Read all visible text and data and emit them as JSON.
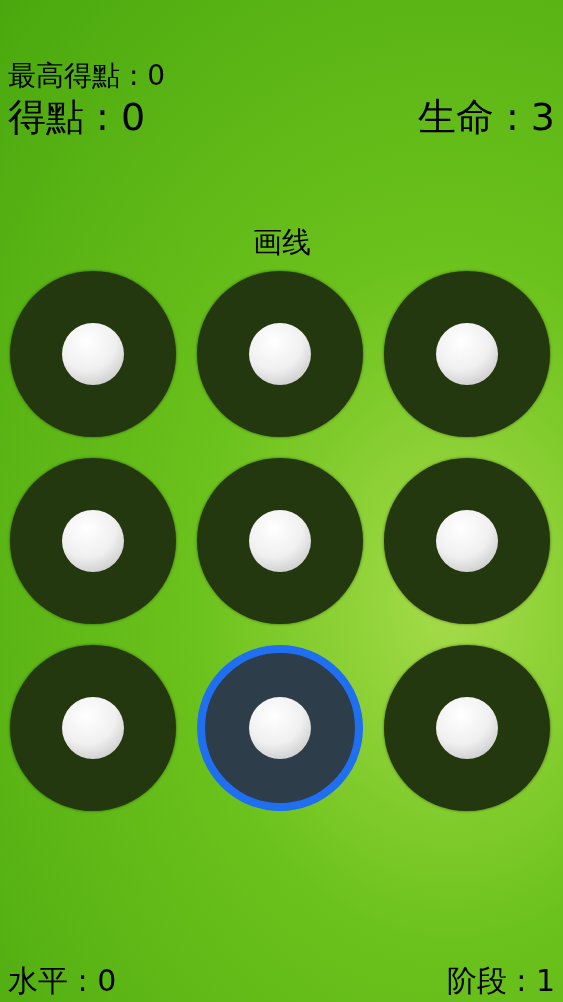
{
  "high_score": "最高得點 : 0",
  "score": "得點 : 0",
  "lives": "生命 : 3",
  "instruction": "画线",
  "dots": [
    {
      "selected": false
    },
    {
      "selected": false
    },
    {
      "selected": false
    },
    {
      "selected": false
    },
    {
      "selected": false
    },
    {
      "selected": false
    },
    {
      "selected": false
    },
    {
      "selected": true
    },
    {
      "selected": false
    }
  ],
  "level_label": "水平 : 0",
  "stage": "阶段 : 1"
}
